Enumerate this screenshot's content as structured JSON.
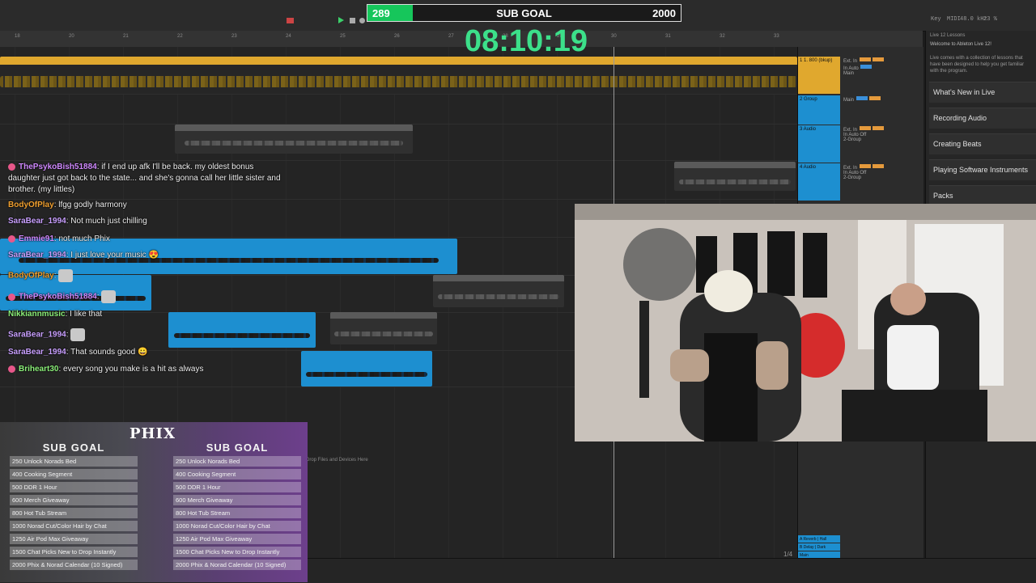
{
  "subgoal": {
    "current": "289",
    "title": "SUB GOAL",
    "target": "2000",
    "progress": 0.1445
  },
  "timer": "08:10:19",
  "daw": {
    "ruler_ticks": [
      "18",
      "20",
      "21",
      "22",
      "23",
      "24",
      "25",
      "26",
      "27",
      "28",
      "29",
      "30",
      "31",
      "32",
      "33"
    ],
    "drop_hint": "Drop Files and Devices Here",
    "page_indicator": "1/4",
    "top_right": [
      "Key",
      "MIDI",
      "48.0 kHz",
      "23 %"
    ],
    "mixer_tracks": [
      {
        "name": "1 1. 800 (bkup)"
      },
      {
        "name": "2 Group"
      },
      {
        "name": "3 Audio"
      },
      {
        "name": "4 Audio"
      }
    ],
    "mixer_labels": {
      "ext_in": "Ext. In",
      "main": "Main",
      "auto": "Auto",
      "off": "Off",
      "in": "In",
      "group": "2-Group"
    },
    "returns": [
      "A Reverb | Hall",
      "B Delay | Dark",
      "Main"
    ]
  },
  "lessons": {
    "header": "Live 12 Lessons",
    "intro_title": "Welcome to Ableton Live 12!",
    "intro_text": "Live comes with a collection of lessons that have been designed to help you get familiar with the program.",
    "items": [
      "What's New in Live",
      "Recording Audio",
      "Creating Beats",
      "Playing Software Instruments",
      "Packs"
    ]
  },
  "chat": [
    {
      "user": "ThePsykoBish51884",
      "user_color": "#d089ff",
      "text": "if I end up afk I'll be back. my oldest bonus daughter just got back to the state... and she's gonna call her little sister and brother. (my littles)",
      "badge": true
    },
    {
      "user": "BodyOfPlay",
      "user_color": "#f0a030",
      "text": "lfgg godly harmony",
      "badge": false
    },
    {
      "user": "SaraBear_1994",
      "user_color": "#c9a0ff",
      "text": "Not much just chilling",
      "badge": false
    },
    {
      "user": "Emmie91",
      "user_color": "#d089ff",
      "text": "not much Phix",
      "badge": true
    },
    {
      "user": "SaraBear_1994",
      "user_color": "#c9a0ff",
      "text": "I just love your music 😍",
      "badge": false
    },
    {
      "user": "BodyOfPlay",
      "user_color": "#f0a030",
      "text": "",
      "badge": false,
      "emote": true
    },
    {
      "user": "ThePsykoBish51884",
      "user_color": "#d089ff",
      "text": "",
      "badge": true,
      "emote": true
    },
    {
      "user": "Nikkiannmusic",
      "user_color": "#8cf07a",
      "text": "I like that",
      "badge": false
    },
    {
      "user": "SaraBear_1994",
      "user_color": "#c9a0ff",
      "text": "",
      "badge": false,
      "emote": true
    },
    {
      "user": "SaraBear_1994",
      "user_color": "#c9a0ff",
      "text": "That sounds good 😀",
      "badge": false
    },
    {
      "user": "Briheart30",
      "user_color": "#8cf07a",
      "text": "every song you make is a hit as always",
      "badge": true
    }
  ],
  "goals": {
    "logo": "PHIX",
    "title": "SUB GOAL",
    "items": [
      "250 Unlock Norads Bed",
      "400 Cooking Segment",
      "500 DDR 1 Hour",
      "600 Merch Giveaway",
      "800 Hot Tub Stream",
      "1000 Norad Cut/Color Hair by Chat",
      "1250 Air Pod Max Giveaway",
      "1500 Chat Picks New to Drop Instantly",
      "2000 Phix & Norad Calendar (10 Signed)"
    ]
  },
  "colors": {
    "accent_green": "#16c65b",
    "timer_green": "#3ce08a",
    "clip_blue": "#1d8fd0",
    "clip_yellow": "#e0a82e"
  }
}
